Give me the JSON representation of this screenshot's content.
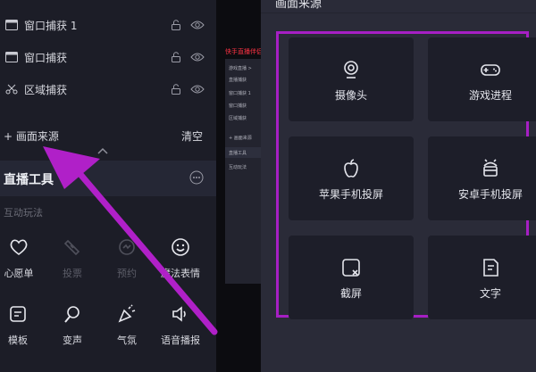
{
  "sources": [
    {
      "icon": "window-icon",
      "label": "窗口捕获 1"
    },
    {
      "icon": "window-icon",
      "label": "窗口捕获"
    },
    {
      "icon": "scissors-icon",
      "label": "区域捕获"
    }
  ],
  "add_source_label": "+ 画面来源",
  "clear_label": "清空",
  "tools": {
    "title": "直播工具",
    "section_label": "互动玩法",
    "items": [
      {
        "label": "心愿单",
        "enabled": true
      },
      {
        "label": "投票",
        "enabled": false
      },
      {
        "label": "预约",
        "enabled": false
      },
      {
        "label": "魔法表情",
        "enabled": true
      },
      {
        "label": "模板",
        "enabled": true
      },
      {
        "label": "变声",
        "enabled": true
      },
      {
        "label": "气氛",
        "enabled": true
      },
      {
        "label": "语音播报",
        "enabled": true
      }
    ]
  },
  "preview": {
    "title": "快手直播伴侣",
    "lines": [
      "游戏直播 >",
      "直播捕获",
      "窗口捕获 1",
      "窗口捕获",
      "区域捕获",
      "+ 画面来源",
      "直播工具",
      "互动玩法"
    ]
  },
  "dialog": {
    "title": "画面来源",
    "cards": [
      {
        "icon": "camera-icon",
        "label": "摄像头"
      },
      {
        "icon": "gamepad-icon",
        "label": "游戏进程"
      },
      {
        "icon": "apple-icon",
        "label": "苹果手机投屏"
      },
      {
        "icon": "android-icon",
        "label": "安卓手机投屏"
      },
      {
        "icon": "screenshot-icon",
        "label": "截屏"
      },
      {
        "icon": "text-icon",
        "label": "文字"
      }
    ]
  },
  "colors": {
    "highlight": "#a61fc4",
    "arrow": "#b020c8",
    "panel_bg": "#1c1d27",
    "card_bg": "#1d1e29"
  }
}
